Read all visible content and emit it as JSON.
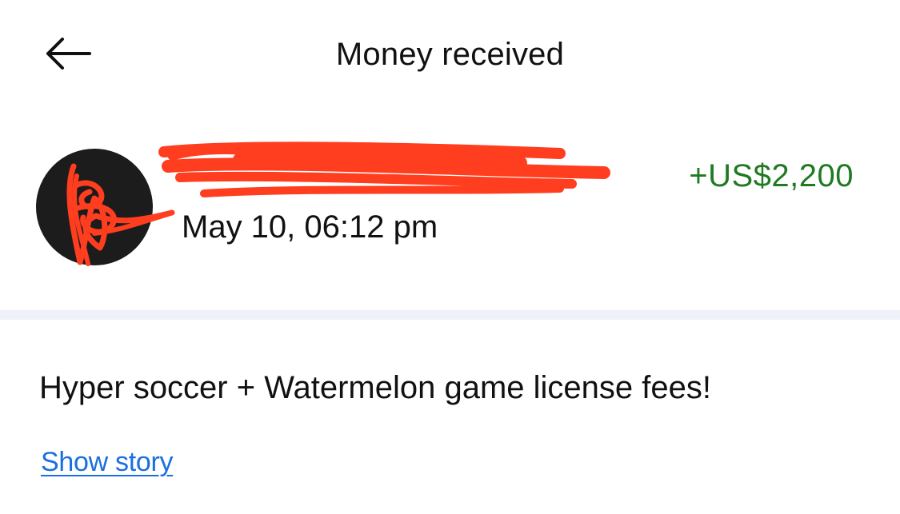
{
  "header": {
    "back_icon": "arrow-left-icon",
    "title": "Money received"
  },
  "transaction": {
    "avatar_icon": "avatar",
    "sender_name": "",
    "date": "May 10, 06:12 pm",
    "amount": "+US$2,200",
    "amount_color": "#1f7a22",
    "redaction_color": "#ff3d1f"
  },
  "details": {
    "note": "Hyper soccer + Watermelon game license fees!",
    "story_link": "Show story",
    "link_color": "#1a6fe0"
  }
}
